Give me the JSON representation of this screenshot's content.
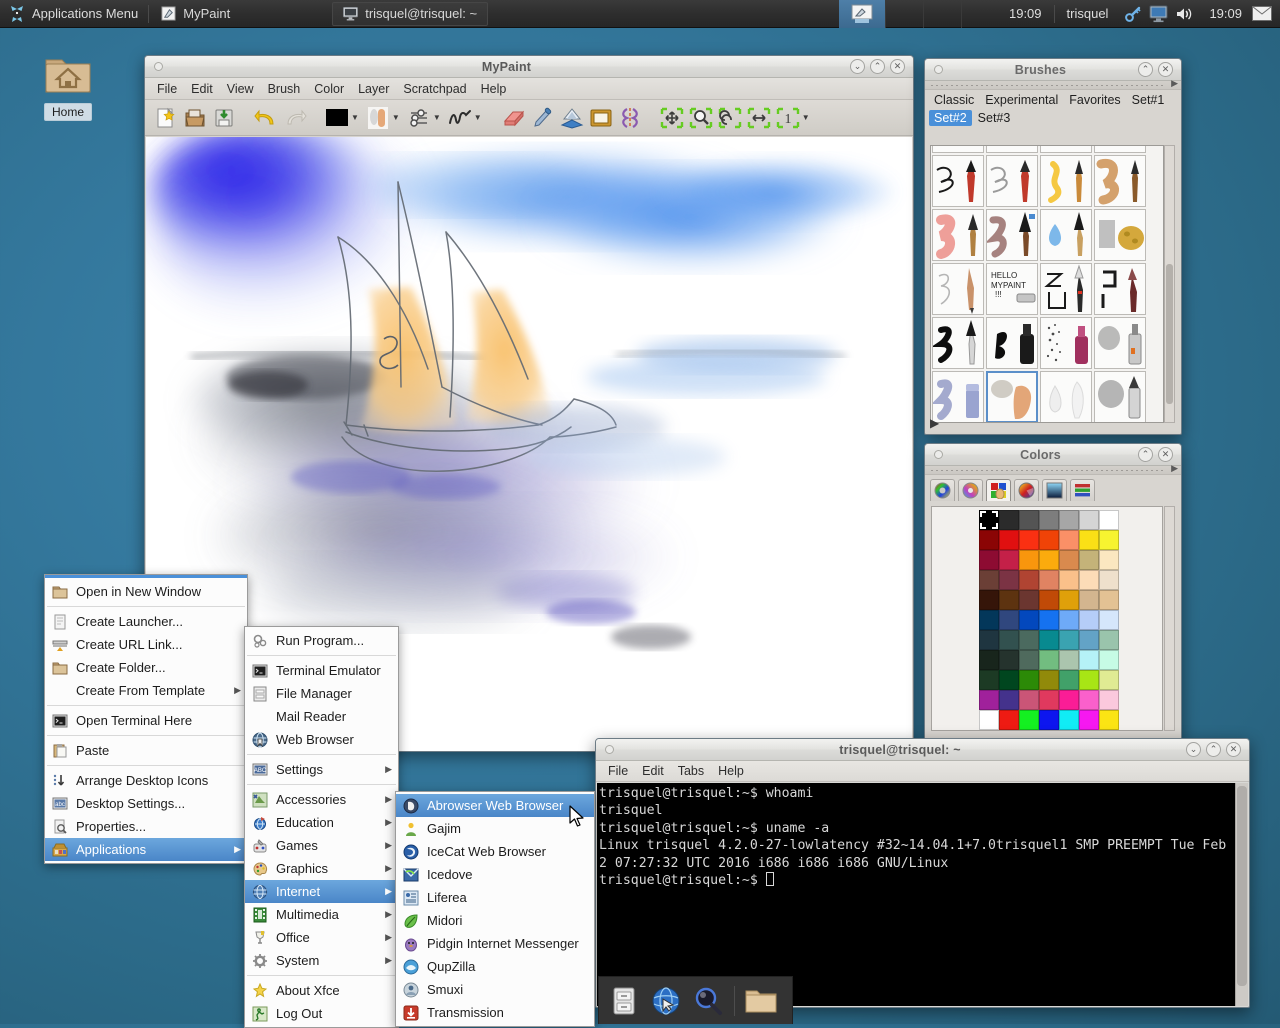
{
  "panel": {
    "apps_menu_label": "Applications Menu",
    "apps_menu_icon": "xfce-mouse-icon",
    "tasks": [
      {
        "label": "MyPaint",
        "icon": "mypaint-icon",
        "active": false
      },
      {
        "label": "trisquel@trisquel: ~",
        "icon": "terminal-icon",
        "active": false
      }
    ],
    "workspace_clock": "19:09",
    "user": "trisquel",
    "tray": [
      {
        "name": "keyring-icon"
      },
      {
        "name": "display-icon"
      },
      {
        "name": "volume-icon"
      }
    ],
    "clock": "19:09",
    "mail_icon": "mail-icon"
  },
  "desktop": {
    "home_icon_label": "Home",
    "home_icon": "home-folder-icon",
    "wallpaper_color": "#34789d"
  },
  "mypaint": {
    "title": "MyPaint",
    "menus": [
      "File",
      "Edit",
      "View",
      "Brush",
      "Color",
      "Layer",
      "Scratchpad",
      "Help"
    ],
    "toolbar": [
      {
        "name": "new-document-icon",
        "has_caret": false
      },
      {
        "name": "open-document-icon",
        "has_caret": false
      },
      {
        "name": "save-document-icon",
        "has_caret": false
      },
      {
        "name": "undo-icon",
        "has_caret": false
      },
      {
        "name": "redo-icon",
        "has_caret": false
      },
      {
        "name": "color-swatch-icon",
        "has_caret": true
      },
      {
        "name": "brush-selector-icon",
        "has_caret": true
      },
      {
        "name": "brush-settings-icon",
        "has_caret": true
      },
      {
        "name": "stroke-preview-icon",
        "has_caret": true
      },
      {
        "name": "eraser-icon",
        "has_caret": false
      },
      {
        "name": "color-picker-icon",
        "has_caret": false
      },
      {
        "name": "layers-icon",
        "has_caret": false
      },
      {
        "name": "frame-icon",
        "has_caret": false
      },
      {
        "name": "symmetry-icon",
        "has_caret": false
      },
      {
        "name": "pan-view-icon",
        "has_caret": false
      },
      {
        "name": "zoom-view-icon",
        "has_caret": false
      },
      {
        "name": "rotate-view-icon",
        "has_caret": false
      },
      {
        "name": "mirror-view-icon",
        "has_caret": false
      },
      {
        "name": "reset-view-icon",
        "has_caret": false
      },
      {
        "name": "overflow-icon",
        "has_caret": false
      }
    ],
    "foreground_color": "#000000",
    "window_buttons": [
      "minimize",
      "maximize",
      "close"
    ],
    "artwork_description": "watercolour sailboat on water with blue sky wash"
  },
  "brushes": {
    "title": "Brushes",
    "tabs": [
      "Classic",
      "Experimental",
      "Favorites",
      "Set#1",
      "Set#2",
      "Set#3"
    ],
    "selected_tab": "Set#2",
    "expand_label": "▶",
    "selected_brush_index": 17,
    "brush_count": 20
  },
  "colors": {
    "title": "Colors",
    "tabs": [
      {
        "name": "hsv-wheel-icon",
        "selected": false
      },
      {
        "name": "hcy-wheel-icon",
        "selected": false
      },
      {
        "name": "palette-icon",
        "selected": true
      },
      {
        "name": "color-changer-icon",
        "selected": false
      },
      {
        "name": "rgb-square-icon",
        "selected": false
      },
      {
        "name": "sliders-icon",
        "selected": false
      }
    ],
    "selected_swatch": "#000000",
    "palette": [
      [
        "#000000",
        "#2b2b2b",
        "#545454",
        "#7d7d7d",
        "#a6a6a6",
        "#d5d5d5",
        "#ffffff"
      ],
      [
        "#8b0505",
        "#e01010",
        "#fa3012",
        "#f04307",
        "#fa9067",
        "#fae016",
        "#f7f430"
      ],
      [
        "#8d0b32",
        "#c42048",
        "#f9960d",
        "#fbab0d",
        "#d98a4e",
        "#c4b379",
        "#fbe7c0"
      ],
      [
        "#6b3f36",
        "#7b3344",
        "#b04432",
        "#e08362",
        "#fac08a",
        "#fcdcb7",
        "#eee0cc"
      ],
      [
        "#351509",
        "#5d3310",
        "#6b3630",
        "#c04a07",
        "#dfa00a",
        "#d3b58f",
        "#e3c294"
      ],
      [
        "#03375a",
        "#30477e",
        "#0348bd",
        "#1572f0",
        "#6eaaf8",
        "#b5cdf8",
        "#d5e6fb"
      ],
      [
        "#1f3540",
        "#32514f",
        "#4b6a5f",
        "#088a90",
        "#3aa3b1",
        "#63a3c6",
        "#9ac4ac"
      ],
      [
        "#18251c",
        "#25332d",
        "#4f6a5d",
        "#72bd80",
        "#abc5ae",
        "#b5f2f7",
        "#c6fbe5"
      ],
      [
        "#1c3a24",
        "#00461f",
        "#2c8a07",
        "#918a0a",
        "#41a169",
        "#a8e515",
        "#e0eb93"
      ],
      [
        "#a0219b",
        "#44328c",
        "#ca5577",
        "#e0395e",
        "#fa1d96",
        "#fa60cb",
        "#fbc8dd"
      ],
      [
        "#ffffff",
        "#ee1b13",
        "#14f021",
        "#0d16ef",
        "#11ecf5",
        "#f618f1",
        "#fbe414"
      ]
    ]
  },
  "terminal": {
    "title": "trisquel@trisquel: ~",
    "menus": [
      "File",
      "Edit",
      "Tabs",
      "Help"
    ],
    "content": "trisquel@trisquel:~$ whoami\ntrisquel\ntrisquel@trisquel:~$ uname -a\nLinux trisquel 4.2.0-27-lowlatency #32~14.04.1+7.0trisquel1 SMP PREEMPT Tue Feb\n2 07:27:32 UTC 2016 i686 i686 i686 GNU/Linux\ntrisquel@trisquel:~$ "
  },
  "context_menu": {
    "items": [
      {
        "label": "Open in New Window",
        "icon": "open-window-icon",
        "submenu": false,
        "selected": false
      },
      {
        "sep": true
      },
      {
        "label": "Create Launcher...",
        "icon": "launcher-icon",
        "submenu": false,
        "selected": false
      },
      {
        "label": "Create URL Link...",
        "icon": "url-link-icon",
        "submenu": false,
        "selected": false
      },
      {
        "label": "Create Folder...",
        "icon": "folder-icon",
        "submenu": false,
        "selected": false
      },
      {
        "label": "Create From Template",
        "icon": "none-icon",
        "submenu": true,
        "selected": false
      },
      {
        "sep": true
      },
      {
        "label": "Open Terminal Here",
        "icon": "terminal-icon",
        "submenu": false,
        "selected": false
      },
      {
        "sep": true
      },
      {
        "label": "Paste",
        "icon": "paste-icon",
        "submenu": false,
        "selected": false
      },
      {
        "sep": true
      },
      {
        "label": "Arrange Desktop Icons",
        "icon": "arrange-icon",
        "submenu": false,
        "selected": false
      },
      {
        "label": "Desktop Settings...",
        "icon": "desktop-settings-icon",
        "submenu": false,
        "selected": false
      },
      {
        "label": "Properties...",
        "icon": "properties-icon",
        "submenu": false,
        "selected": false
      },
      {
        "label": "Applications",
        "icon": "applications-icon",
        "submenu": true,
        "selected": true
      }
    ]
  },
  "applications_menu": {
    "items": [
      {
        "label": "Run Program...",
        "icon": "run-program-icon",
        "submenu": false,
        "selected": false
      },
      {
        "sep": true
      },
      {
        "label": "Terminal Emulator",
        "icon": "terminal-icon",
        "submenu": false,
        "selected": false
      },
      {
        "label": "File Manager",
        "icon": "file-manager-icon",
        "submenu": false,
        "selected": false
      },
      {
        "label": "Mail Reader",
        "icon": "none-icon",
        "submenu": false,
        "selected": false
      },
      {
        "label": "Web Browser",
        "icon": "web-browser-icon",
        "submenu": false,
        "selected": false
      },
      {
        "sep": true
      },
      {
        "label": "Settings",
        "icon": "settings-icon",
        "submenu": true,
        "selected": false
      },
      {
        "sep": true
      },
      {
        "label": "Accessories",
        "icon": "accessories-icon",
        "submenu": true,
        "selected": false
      },
      {
        "label": "Education",
        "icon": "education-icon",
        "submenu": true,
        "selected": false
      },
      {
        "label": "Games",
        "icon": "games-icon",
        "submenu": true,
        "selected": false
      },
      {
        "label": "Graphics",
        "icon": "graphics-icon",
        "submenu": true,
        "selected": false
      },
      {
        "label": "Internet",
        "icon": "internet-icon",
        "submenu": true,
        "selected": true
      },
      {
        "label": "Multimedia",
        "icon": "multimedia-icon",
        "submenu": true,
        "selected": false
      },
      {
        "label": "Office",
        "icon": "office-icon",
        "submenu": true,
        "selected": false
      },
      {
        "label": "System",
        "icon": "system-icon",
        "submenu": true,
        "selected": false
      },
      {
        "sep": true
      },
      {
        "label": "About Xfce",
        "icon": "about-xfce-icon",
        "submenu": false,
        "selected": false
      },
      {
        "label": "Log Out",
        "icon": "log-out-icon",
        "submenu": false,
        "selected": false
      }
    ]
  },
  "internet_menu": {
    "items": [
      {
        "label": "Abrowser Web Browser",
        "icon": "abrowser-icon",
        "selected": true
      },
      {
        "label": "Gajim",
        "icon": "gajim-icon",
        "selected": false
      },
      {
        "label": "IceCat Web Browser",
        "icon": "icecat-icon",
        "selected": false
      },
      {
        "label": "Icedove",
        "icon": "icedove-icon",
        "selected": false
      },
      {
        "label": "Liferea",
        "icon": "liferea-icon",
        "selected": false
      },
      {
        "label": "Midori",
        "icon": "midori-icon",
        "selected": false
      },
      {
        "label": "Pidgin Internet Messenger",
        "icon": "pidgin-icon",
        "selected": false
      },
      {
        "label": "QupZilla",
        "icon": "qupzilla-icon",
        "selected": false
      },
      {
        "label": "Smuxi",
        "icon": "smuxi-icon",
        "selected": false
      },
      {
        "label": "Transmission",
        "icon": "transmission-icon",
        "selected": false
      }
    ]
  },
  "dock": {
    "items": [
      {
        "name": "file-manager-icon"
      },
      {
        "name": "web-browser-icon"
      },
      {
        "name": "search-icon"
      },
      {
        "name": "folder-icon"
      }
    ]
  }
}
